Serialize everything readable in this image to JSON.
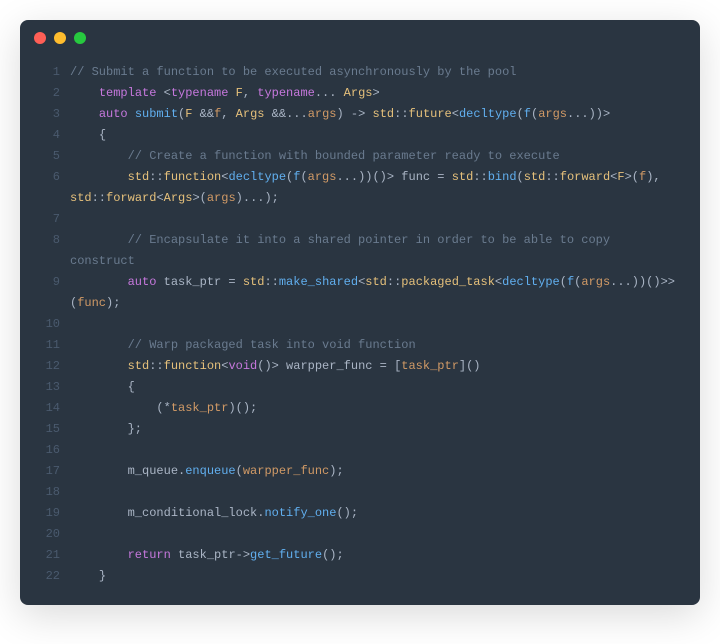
{
  "window": {
    "dots": {
      "red": "#ff5f56",
      "yellow": "#ffbd2e",
      "green": "#27c93f"
    }
  },
  "code": {
    "lines": [
      {
        "n": 1,
        "tokens": [
          [
            "comment",
            "// Submit a function to be executed asynchronously by the pool"
          ]
        ]
      },
      {
        "n": 2,
        "tokens": [
          [
            "punct",
            "    "
          ],
          [
            "keyword",
            "template"
          ],
          [
            "punct",
            " <"
          ],
          [
            "keyword",
            "typename"
          ],
          [
            "punct",
            " "
          ],
          [
            "type",
            "F"
          ],
          [
            "punct",
            ", "
          ],
          [
            "keyword",
            "typename"
          ],
          [
            "punct",
            "... "
          ],
          [
            "type",
            "Args"
          ],
          [
            "punct",
            ">"
          ]
        ]
      },
      {
        "n": 3,
        "tokens": [
          [
            "punct",
            "    "
          ],
          [
            "keyword",
            "auto"
          ],
          [
            "punct",
            " "
          ],
          [
            "func",
            "submit"
          ],
          [
            "punct",
            "("
          ],
          [
            "type",
            "F"
          ],
          [
            "punct",
            " &&"
          ],
          [
            "param",
            "f"
          ],
          [
            "punct",
            ", "
          ],
          [
            "type",
            "Args"
          ],
          [
            "punct",
            " &&..."
          ],
          [
            "param",
            "args"
          ],
          [
            "punct",
            ") -> "
          ],
          [
            "type",
            "std"
          ],
          [
            "punct",
            "::"
          ],
          [
            "type",
            "future"
          ],
          [
            "punct",
            "<"
          ],
          [
            "func",
            "decltype"
          ],
          [
            "punct",
            "("
          ],
          [
            "func",
            "f"
          ],
          [
            "punct",
            "("
          ],
          [
            "param",
            "args"
          ],
          [
            "punct",
            "...))>"
          ]
        ]
      },
      {
        "n": 4,
        "tokens": [
          [
            "punct",
            "    {"
          ]
        ]
      },
      {
        "n": 5,
        "tokens": [
          [
            "punct",
            "        "
          ],
          [
            "comment",
            "// Create a function with bounded parameter ready to execute"
          ]
        ]
      },
      {
        "n": 6,
        "tokens": [
          [
            "punct",
            "        "
          ],
          [
            "type",
            "std"
          ],
          [
            "punct",
            "::"
          ],
          [
            "type",
            "function"
          ],
          [
            "punct",
            "<"
          ],
          [
            "func",
            "decltype"
          ],
          [
            "punct",
            "("
          ],
          [
            "func",
            "f"
          ],
          [
            "punct",
            "("
          ],
          [
            "param",
            "args"
          ],
          [
            "punct",
            "...))"
          ],
          [
            "punct",
            "()> func = "
          ],
          [
            "type",
            "std"
          ],
          [
            "punct",
            "::"
          ],
          [
            "func",
            "bind"
          ],
          [
            "punct",
            "("
          ],
          [
            "type",
            "std"
          ],
          [
            "punct",
            "::"
          ],
          [
            "type",
            "forward"
          ],
          [
            "punct",
            "<"
          ],
          [
            "type",
            "F"
          ],
          [
            "punct",
            ">("
          ],
          [
            "param",
            "f"
          ],
          [
            "punct",
            "), "
          ],
          [
            "type",
            "std"
          ],
          [
            "punct",
            "::"
          ],
          [
            "type",
            "forward"
          ],
          [
            "punct",
            "<"
          ],
          [
            "type",
            "Args"
          ],
          [
            "punct",
            ">("
          ],
          [
            "param",
            "args"
          ],
          [
            "punct",
            ")...);"
          ]
        ]
      },
      {
        "n": 7,
        "tokens": [
          [
            "punct",
            " "
          ]
        ]
      },
      {
        "n": 8,
        "tokens": [
          [
            "punct",
            "        "
          ],
          [
            "comment",
            "// Encapsulate it into a shared pointer in order to be able to copy construct"
          ]
        ]
      },
      {
        "n": 9,
        "tokens": [
          [
            "punct",
            "        "
          ],
          [
            "keyword",
            "auto"
          ],
          [
            "punct",
            " task_ptr = "
          ],
          [
            "type",
            "std"
          ],
          [
            "punct",
            "::"
          ],
          [
            "func",
            "make_shared"
          ],
          [
            "punct",
            "<"
          ],
          [
            "type",
            "std"
          ],
          [
            "punct",
            "::"
          ],
          [
            "type",
            "packaged_task"
          ],
          [
            "punct",
            "<"
          ],
          [
            "func",
            "decltype"
          ],
          [
            "punct",
            "("
          ],
          [
            "func",
            "f"
          ],
          [
            "punct",
            "("
          ],
          [
            "param",
            "args"
          ],
          [
            "punct",
            "...))()>>("
          ],
          [
            "param",
            "func"
          ],
          [
            "punct",
            ");"
          ]
        ]
      },
      {
        "n": 10,
        "tokens": [
          [
            "punct",
            " "
          ]
        ]
      },
      {
        "n": 11,
        "tokens": [
          [
            "punct",
            "        "
          ],
          [
            "comment",
            "// Warp packaged task into void function"
          ]
        ]
      },
      {
        "n": 12,
        "tokens": [
          [
            "punct",
            "        "
          ],
          [
            "type",
            "std"
          ],
          [
            "punct",
            "::"
          ],
          [
            "type",
            "function"
          ],
          [
            "punct",
            "<"
          ],
          [
            "keyword",
            "void"
          ],
          [
            "punct",
            "()> warpper_func = ["
          ],
          [
            "param",
            "task_ptr"
          ],
          [
            "punct",
            "]()"
          ]
        ]
      },
      {
        "n": 13,
        "tokens": [
          [
            "punct",
            "        {"
          ]
        ]
      },
      {
        "n": 14,
        "tokens": [
          [
            "punct",
            "            (*"
          ],
          [
            "param",
            "task_ptr"
          ],
          [
            "punct",
            ")();"
          ]
        ]
      },
      {
        "n": 15,
        "tokens": [
          [
            "punct",
            "        };"
          ]
        ]
      },
      {
        "n": 16,
        "tokens": [
          [
            "punct",
            " "
          ]
        ]
      },
      {
        "n": 17,
        "tokens": [
          [
            "punct",
            "        m_queue."
          ],
          [
            "func",
            "enqueue"
          ],
          [
            "punct",
            "("
          ],
          [
            "param",
            "warpper_func"
          ],
          [
            "punct",
            ");"
          ]
        ]
      },
      {
        "n": 18,
        "tokens": [
          [
            "punct",
            " "
          ]
        ]
      },
      {
        "n": 19,
        "tokens": [
          [
            "punct",
            "        m_conditional_lock."
          ],
          [
            "func",
            "notify_one"
          ],
          [
            "punct",
            "();"
          ]
        ]
      },
      {
        "n": 20,
        "tokens": [
          [
            "punct",
            " "
          ]
        ]
      },
      {
        "n": 21,
        "tokens": [
          [
            "punct",
            "        "
          ],
          [
            "keyword",
            "return"
          ],
          [
            "punct",
            " task_ptr->"
          ],
          [
            "func",
            "get_future"
          ],
          [
            "punct",
            "();"
          ]
        ]
      },
      {
        "n": 22,
        "tokens": [
          [
            "punct",
            "    }"
          ]
        ]
      }
    ]
  }
}
